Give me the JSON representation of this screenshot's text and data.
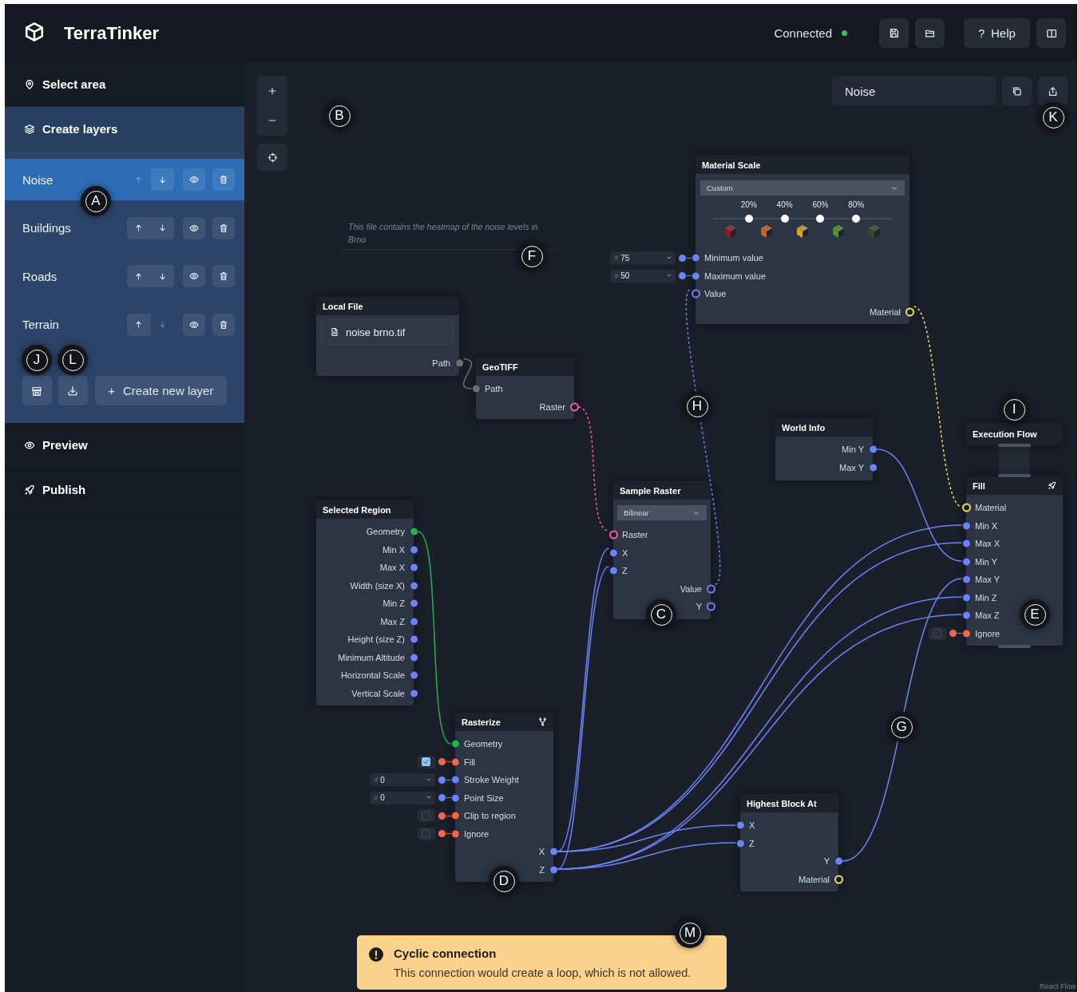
{
  "header": {
    "app_name": "TerraTinker",
    "status": "Connected",
    "connected": true,
    "help": {
      "glyph": "?",
      "label": "Help"
    }
  },
  "sidebar": {
    "sections": [
      {
        "label": "Select area",
        "expanded": false
      },
      {
        "label": "Create layers",
        "expanded": true
      },
      {
        "label": "Preview",
        "expanded": false
      },
      {
        "label": "Publish",
        "expanded": false
      }
    ],
    "layers": [
      {
        "name": "Noise",
        "selected": true,
        "up_disabled": true,
        "down_disabled": false
      },
      {
        "name": "Buildings",
        "selected": false,
        "up_disabled": false,
        "down_disabled": false
      },
      {
        "name": "Roads",
        "selected": false,
        "up_disabled": false,
        "down_disabled": false
      },
      {
        "name": "Terrain",
        "selected": false,
        "up_disabled": false,
        "down_disabled": true
      }
    ],
    "create_button": {
      "glyph": "+",
      "label": "Create new layer"
    }
  },
  "canvas": {
    "layer_name": "Noise",
    "comment": "This file contains the heatmap of the noise levels in Brno",
    "nodes": [
      {
        "title": "Material Scale",
        "dropdown": "Custom",
        "stops": [
          {
            "label": "20%",
            "level": 0.2
          },
          {
            "label": "40%",
            "level": 0.4
          },
          {
            "label": "60%",
            "level": 0.6
          },
          {
            "label": "80%",
            "level": 0.8
          }
        ],
        "materials": [
          {
            "color": "#8e1c1c"
          },
          {
            "color": "#d2611a"
          },
          {
            "color": "#e0a526"
          },
          {
            "color": "#4f9a1c"
          },
          {
            "color": "#3d4a1e"
          }
        ],
        "inputs": [
          {
            "label": "Minimum value",
            "color": "#6a84f8",
            "hollow": false,
            "input": {
              "kind": "number",
              "prefix": "#",
              "value": "75"
            }
          },
          {
            "label": "Maximum value",
            "color": "#6a84f8",
            "hollow": false,
            "input": {
              "kind": "number",
              "prefix": "#",
              "value": "50"
            }
          },
          {
            "label": "Value",
            "color": "#6a84f8",
            "hollow": true
          }
        ],
        "outputs": [
          {
            "label": "Material",
            "color": "#f3e34b",
            "hollow": true
          }
        ]
      },
      {
        "title": "Local File",
        "file": "noise brno.tif",
        "outputs": [
          {
            "label": "Path",
            "color": "#6f6f6f",
            "hollow": false
          }
        ]
      },
      {
        "title": "GeoTIFF",
        "inputs": [
          {
            "label": "Path",
            "color": "#6f6f6f",
            "hollow": false
          }
        ],
        "outputs": [
          {
            "label": "Raster",
            "color": "#ef5ea9",
            "hollow": true
          }
        ]
      },
      {
        "title": "World Info",
        "outputs": [
          {
            "label": "Min Y",
            "color": "#6a84f8",
            "hollow": false
          },
          {
            "label": "Max Y",
            "color": "#6a84f8",
            "hollow": false
          }
        ]
      },
      {
        "title": "Execution Flow"
      },
      {
        "title": "Fill",
        "inputs": [
          {
            "label": "Material",
            "color": "#f3e34b",
            "hollow": true
          },
          {
            "label": "Min X",
            "color": "#6a84f8",
            "hollow": false
          },
          {
            "label": "Max X",
            "color": "#6a84f8",
            "hollow": false
          },
          {
            "label": "Min Y",
            "color": "#6a84f8",
            "hollow": false
          },
          {
            "label": "Max Y",
            "color": "#6a84f8",
            "hollow": false
          },
          {
            "label": "Min Z",
            "color": "#6a84f8",
            "hollow": false
          },
          {
            "label": "Max Z",
            "color": "#6a84f8",
            "hollow": false
          },
          {
            "label": "Ignore",
            "color": "#f2664c",
            "hollow": false,
            "input": {
              "kind": "checkbox",
              "checked": false
            }
          }
        ]
      },
      {
        "title": "Sample Raster",
        "dropdown": "Bilinear",
        "inputs": [
          {
            "label": "Raster",
            "color": "#ef5ea9",
            "hollow": true
          },
          {
            "label": "X",
            "color": "#6a84f8",
            "hollow": false
          },
          {
            "label": "Z",
            "color": "#6a84f8",
            "hollow": false
          }
        ],
        "outputs": [
          {
            "label": "Value",
            "color": "#6a84f8",
            "hollow": true
          },
          {
            "label": "Y",
            "color": "#6a84f8",
            "hollow": true
          }
        ]
      },
      {
        "title": "Selected Region",
        "outputs": [
          {
            "label": "Geometry",
            "color": "#20b24b",
            "hollow": false
          },
          {
            "label": "Min X",
            "color": "#6a84f8",
            "hollow": false
          },
          {
            "label": "Max X",
            "color": "#6a84f8",
            "hollow": false
          },
          {
            "label": "Width (size X)",
            "color": "#6a84f8",
            "hollow": false
          },
          {
            "label": "Min Z",
            "color": "#6a84f8",
            "hollow": false
          },
          {
            "label": "Max Z",
            "color": "#6a84f8",
            "hollow": false
          },
          {
            "label": "Height (size Z)",
            "color": "#6a84f8",
            "hollow": false
          },
          {
            "label": "Minimum Altitude",
            "color": "#6a84f8",
            "hollow": false
          },
          {
            "label": "Horizontal Scale",
            "color": "#6a84f8",
            "hollow": false
          },
          {
            "label": "Vertical Scale",
            "color": "#6a84f8",
            "hollow": false
          }
        ]
      },
      {
        "title": "Rasterize",
        "inputs": [
          {
            "label": "Geometry",
            "color": "#20b24b",
            "hollow": false
          },
          {
            "label": "Fill",
            "color": "#f2664c",
            "hollow": false,
            "input": {
              "kind": "checkbox",
              "checked": true
            }
          },
          {
            "label": "Stroke Weight",
            "color": "#6a84f8",
            "hollow": false,
            "input": {
              "kind": "number",
              "prefix": "#",
              "value": "0"
            }
          },
          {
            "label": "Point Size",
            "color": "#6a84f8",
            "hollow": false,
            "input": {
              "kind": "number",
              "prefix": "#",
              "value": "0"
            }
          },
          {
            "label": "Clip to region",
            "color": "#f2664c",
            "hollow": false,
            "input": {
              "kind": "checkbox",
              "checked": false
            }
          },
          {
            "label": "Ignore",
            "color": "#f2664c",
            "hollow": false,
            "input": {
              "kind": "checkbox",
              "checked": false
            }
          }
        ],
        "outputs": [
          {
            "label": "X",
            "color": "#6a84f8",
            "hollow": false
          },
          {
            "label": "Z",
            "color": "#6a84f8",
            "hollow": false
          }
        ]
      },
      {
        "title": "Highest Block At",
        "inputs": [
          {
            "label": "X",
            "color": "#6a84f8",
            "hollow": false
          },
          {
            "label": "Z",
            "color": "#6a84f8",
            "hollow": false
          }
        ],
        "outputs": [
          {
            "label": "Y",
            "color": "#6a84f8",
            "hollow": false
          },
          {
            "label": "Material",
            "color": "#f3e34b",
            "hollow": true
          }
        ]
      }
    ],
    "toast": {
      "title": "Cyclic connection",
      "message": "This connection would create a loop, which is not allowed."
    },
    "attribution": "React Flow"
  },
  "callouts": [
    {
      "label": "B"
    },
    {
      "label": "K"
    },
    {
      "label": "A"
    },
    {
      "label": "F"
    },
    {
      "label": "J"
    },
    {
      "label": "L"
    },
    {
      "label": "H"
    },
    {
      "label": "I"
    },
    {
      "label": "C"
    },
    {
      "label": "E"
    },
    {
      "label": "G"
    },
    {
      "label": "D"
    },
    {
      "label": "M"
    }
  ]
}
